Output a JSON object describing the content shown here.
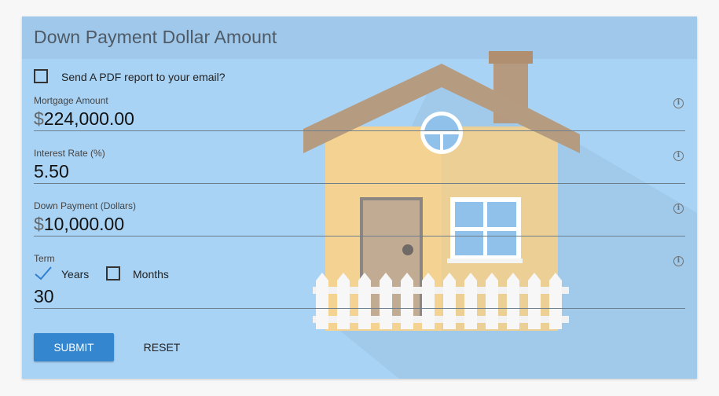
{
  "header": {
    "title": "Down Payment Dollar Amount"
  },
  "email_option": {
    "label": "Send A PDF report to your email?",
    "checked": false
  },
  "fields": {
    "mortgage": {
      "label": "Mortgage Amount",
      "prefix": "$",
      "value": "224,000.00"
    },
    "interest": {
      "label": "Interest Rate (%)",
      "value": "5.50"
    },
    "down_payment": {
      "label": "Down Payment (Dollars)",
      "prefix": "$",
      "value": "10,000.00"
    },
    "term": {
      "label": "Term",
      "years_label": "Years",
      "years_checked": true,
      "months_label": "Months",
      "months_checked": false,
      "value": "30"
    }
  },
  "buttons": {
    "submit": "SUBMIT",
    "reset": "RESET"
  },
  "icons": {
    "info": "info-icon",
    "illustration": "house-illustration"
  },
  "colors": {
    "accent": "#3486cf",
    "card": "#a9d3f5",
    "header": "#a0c8ea"
  }
}
